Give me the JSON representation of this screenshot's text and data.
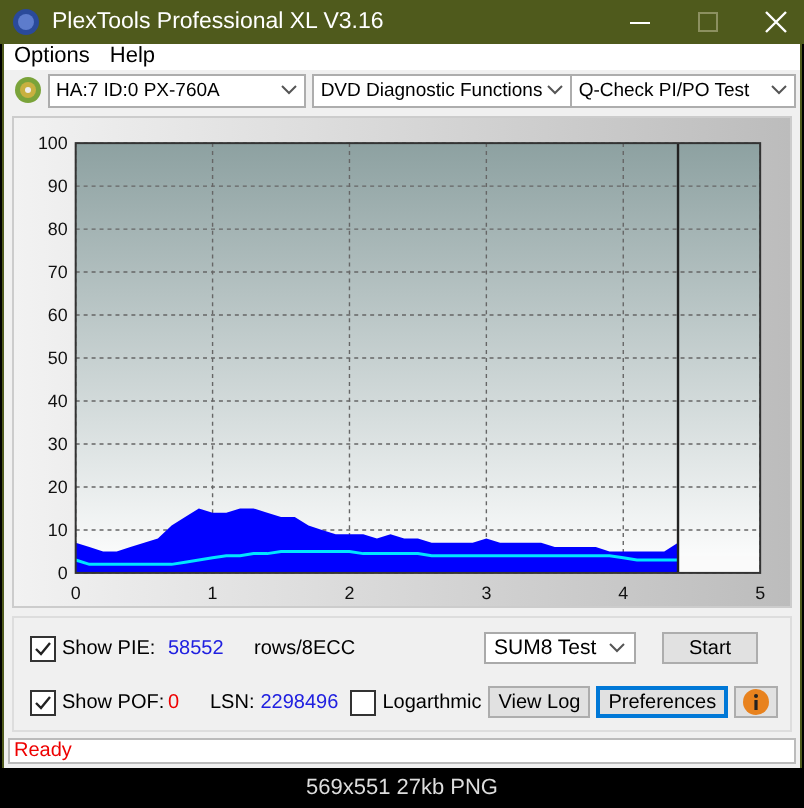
{
  "window": {
    "title": "PlexTools Professional XL V3.16"
  },
  "menu": [
    {
      "label": "Options"
    },
    {
      "label": "Help"
    }
  ],
  "toolbar": [
    {
      "value": "HA:7 ID:0  PX-760A",
      "kind": "drive"
    },
    {
      "value": "DVD Diagnostic Functions",
      "kind": "plain"
    },
    {
      "value": "Q-Check PI/PO Test",
      "kind": "plain"
    }
  ],
  "chart": {
    "chart_data": {
      "type": "area",
      "x": [
        0,
        0.1,
        0.2,
        0.3,
        0.4,
        0.5,
        0.6,
        0.7,
        0.8,
        0.9,
        1.0,
        1.1,
        1.2,
        1.3,
        1.4,
        1.5,
        1.6,
        1.7,
        1.8,
        1.9,
        2.0,
        2.1,
        2.2,
        2.3,
        2.4,
        2.5,
        2.6,
        2.7,
        2.8,
        2.9,
        3.0,
        3.1,
        3.2,
        3.3,
        3.4,
        3.5,
        3.6,
        3.7,
        3.8,
        3.9,
        4.0,
        4.1,
        4.2,
        4.3,
        4.4
      ],
      "series": [
        {
          "color": "#0000ff",
          "values": [
            7,
            6,
            5,
            5,
            6,
            7,
            8,
            11,
            13,
            15,
            14,
            14,
            15,
            15,
            14,
            13,
            13,
            11,
            10,
            9,
            9,
            9,
            8,
            9,
            8,
            8,
            7,
            7,
            7,
            7,
            8,
            7,
            7,
            7,
            7,
            6,
            6,
            6,
            6,
            5,
            5,
            5,
            5,
            5,
            7
          ]
        },
        {
          "type": "line",
          "color": "#00e5ff",
          "values": [
            3,
            2,
            2,
            2,
            2,
            2,
            2,
            2,
            2.5,
            3,
            3.5,
            4,
            4,
            4.5,
            4.5,
            5,
            5,
            5,
            5,
            5,
            5,
            4.5,
            4.5,
            4.5,
            4.5,
            4.5,
            4,
            4,
            4,
            4,
            4,
            4,
            4,
            4,
            4,
            4,
            4,
            4,
            4,
            4,
            3.5,
            3,
            3,
            3,
            3
          ]
        }
      ],
      "grid": true,
      "ref_lines": [
        {
          "axis": "x",
          "value": 4.4
        }
      ],
      "xlim": [
        0,
        5
      ],
      "ylim": [
        0,
        100
      ],
      "xticks": [
        0,
        1,
        2,
        3,
        4,
        5
      ],
      "yticks": [
        0,
        10,
        20,
        30,
        40,
        50,
        60,
        70,
        80,
        90,
        100
      ]
    }
  },
  "controls": {
    "show_pie": {
      "label": "Show PIE:",
      "checked": true,
      "value": "58552",
      "unit": "rows/8ECC"
    },
    "show_pof": {
      "label": "Show POF:",
      "checked": true,
      "value": "0"
    },
    "lsn": {
      "label": "LSN:",
      "value": "2298496"
    },
    "logarithmic": {
      "label": "Logarthmic",
      "checked": false
    },
    "test_select": {
      "value": "SUM8 Test"
    },
    "start_button": {
      "label": "Start"
    },
    "buttons": [
      {
        "kind": "text",
        "label": "View Log",
        "focused": false
      },
      {
        "kind": "text",
        "label": "Preferences",
        "focused": true
      },
      {
        "kind": "info"
      }
    ]
  },
  "status_bar": {
    "text": "Ready"
  },
  "caption": "569x551 27kb PNG"
}
